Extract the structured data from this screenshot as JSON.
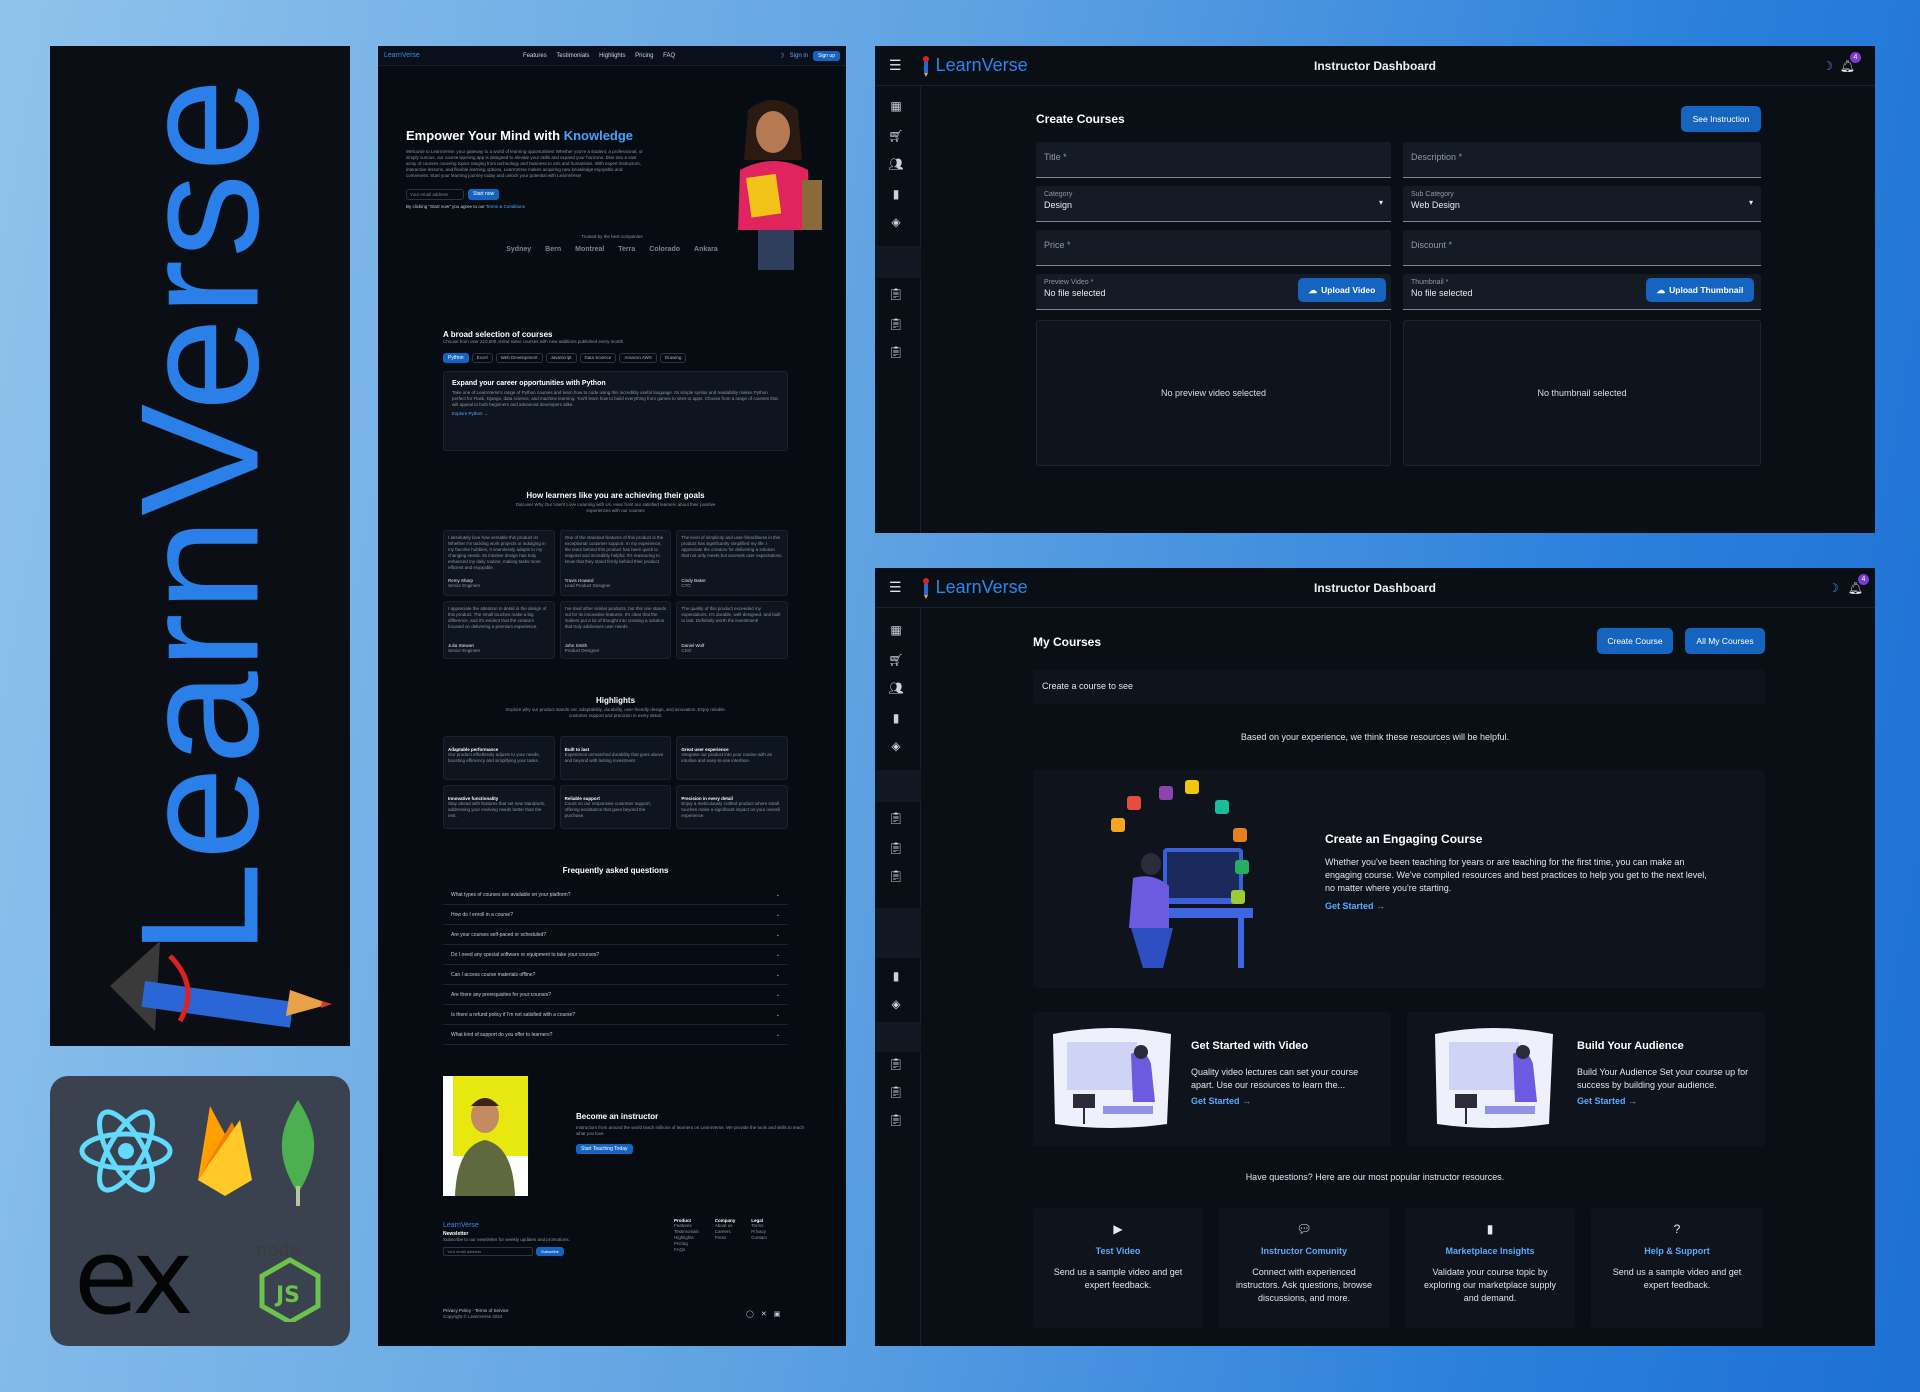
{
  "logo": {
    "wordmark": "LearnVerse"
  },
  "landing": {
    "nav": {
      "brand": "LearnVerse",
      "links": [
        "Features",
        "Testimonials",
        "Highlights",
        "Pricing",
        "FAQ"
      ],
      "signin": "Sign in",
      "signup": "Sign up"
    },
    "hero": {
      "title": "Empower Your Mind with",
      "title_highlight": "Knowledge",
      "text": "Welcome to LearnVerse: your gateway to a world of learning opportunities! Whether you're a student, a professional, or simply curious, our course learning app is designed to elevate your skills and expand your horizons. Dive into a vast array of courses covering topics ranging from technology and business to arts and humanities. With expert instructors, interactive lessons, and flexible learning options, LearnVerse makes acquiring new knowledge enjoyable and convenient. Start your learning journey today and unlock your potential with LearnVerse!",
      "email_placeholder": "Your email address",
      "start_button": "Start now",
      "terms_text": "By clicking \"Start now\" you agree to our",
      "terms_link": "Terms & Conditions"
    },
    "trusted": {
      "label": "Trusted by the best companies",
      "companies": [
        "Sydney",
        "Bern",
        "Montreal",
        "Terra",
        "Colorado",
        "Ankara"
      ]
    },
    "courses": {
      "title": "A broad selection of courses",
      "subtitle": "Choose from over 210,000 online video courses with new additions published every month",
      "tabs": [
        "Python",
        "Excel",
        "Web Development",
        "JavaScript",
        "Data Science",
        "Amazon AWS",
        "Drawing"
      ],
      "card_title": "Expand your career opportunities with Python",
      "card_text": "Take one of LearnVerse's range of Python courses and learn how to code using this incredibly useful language. Its simple syntax and readability makes Python perfect for Flask, Django, data science, and machine learning. You'll learn how to build everything from games to sites to apps. Choose from a range of courses that will appeal to both beginners and advanced developers alike.",
      "card_link": "Explore Python"
    },
    "testimonials": {
      "title": "How learners like you are achieving their goals",
      "subtitle": "Discover Why Our Users Love Learning with Us. Hear from our satisfied learners about their positive experiences with our courses",
      "items": [
        {
          "text": "I absolutely love how versatile this product is! Whether I'm tackling work projects or indulging in my favorite hobbies, it seamlessly adapts to my changing needs. Its intuitive design has truly enhanced my daily routine, making tasks more efficient and enjoyable.",
          "name": "Remy Sharp",
          "role": "Senior Engineer",
          "logo": "Sydney"
        },
        {
          "text": "One of the standout features of this product is the exceptional customer support. In my experience, the team behind this product has been quick to respond and incredibly helpful. It's reassuring to know that they stand firmly behind their product.",
          "name": "Travis Howard",
          "role": "Lead Product Designer",
          "logo": "Bern"
        },
        {
          "text": "The level of simplicity and user-friendliness in this product has significantly simplified my life. I appreciate the creators for delivering a solution that not only meets but exceeds user expectations.",
          "name": "Cindy Baker",
          "role": "CTO",
          "logo": "Montreal"
        },
        {
          "text": "I appreciate the attention to detail in the design of this product. The small touches make a big difference, and it's evident that the creators focused on delivering a premium experience.",
          "name": "Julia Stewart",
          "role": "Senior Engineer",
          "logo": "Terra"
        },
        {
          "text": "I've tried other similar products, but this one stands out for its innovative features. It's clear that the makers put a lot of thought into creating a solution that truly addresses user needs.",
          "name": "John Smith",
          "role": "Product Designer",
          "logo": "Colorado"
        },
        {
          "text": "The quality of this product exceeded my expectations. It's durable, well-designed, and built to last. Definitely worth the investment!",
          "name": "Daniel Wolf",
          "role": "CDO",
          "logo": "Ankara"
        }
      ]
    },
    "highlights": {
      "title": "Highlights",
      "subtitle": "Explore why our product stands out: adaptability, durability, user-friendly design, and innovation. Enjoy reliable customer support and precision in every detail.",
      "items": [
        {
          "title": "Adaptable performance",
          "text": "Our product effortlessly adjusts to your needs, boosting efficiency and simplifying your tasks."
        },
        {
          "title": "Built to last",
          "text": "Experience unmatched durability that goes above and beyond with lasting investment."
        },
        {
          "title": "Great user experience",
          "text": "Integrate our product into your routine with an intuitive and easy-to-use interface."
        },
        {
          "title": "Innovative functionality",
          "text": "Stay ahead with features that set new standards, addressing your evolving needs better than the rest."
        },
        {
          "title": "Reliable support",
          "text": "Count on our responsive customer support, offering assistance that goes beyond the purchase."
        },
        {
          "title": "Precision in every detail",
          "text": "Enjoy a meticulously crafted product where small touches make a significant impact on your overall experience."
        }
      ]
    },
    "faq": {
      "title": "Frequently asked questions",
      "items": [
        "What types of courses are available on your platform?",
        "How do I enroll in a course?",
        "Are your courses self-paced or scheduled?",
        "Do I need any special software or equipment to take your courses?",
        "Can I access course materials offline?",
        "Are there any prerequisites for your courses?",
        "Is there a refund policy if I'm not satisfied with a course?",
        "What kind of support do you offer to learners?"
      ]
    },
    "instructor": {
      "title": "Become an instructor",
      "text": "Instructors from around the world teach millions of learners on LearnVerse. We provide the tools and skills to teach what you love.",
      "button": "Start Teaching Today"
    },
    "footer": {
      "brand": "LearnVerse",
      "newsletter": "Newsletter",
      "newsletter_text": "Subscribe to our newsletter for weekly updates and promotions.",
      "email_placeholder": "Your email address",
      "subscribe": "Subscribe",
      "cols": [
        {
          "title": "Product",
          "items": [
            "Features",
            "Testimonials",
            "Highlights",
            "Pricing",
            "FAQs"
          ]
        },
        {
          "title": "Company",
          "items": [
            "About us",
            "Careers",
            "Press"
          ]
        },
        {
          "title": "Legal",
          "items": [
            "Terms",
            "Privacy",
            "Contact"
          ]
        }
      ],
      "privacy": "Privacy Policy",
      "terms": "Terms of Service",
      "copyright": "Copyright © LearnVerse 2024"
    }
  },
  "dash1": {
    "brand": "LearnVerse",
    "title": "Instructor Dashboard",
    "badge": "4",
    "heading": "Create Courses",
    "see_button": "See Instruction",
    "title_field": "Title *",
    "desc_field": "Description *",
    "category_label": "Category",
    "category_value": "Design",
    "subcat_label": "Sub Category",
    "subcat_value": "Web Design",
    "price_field": "Price *",
    "discount_field": "Discount *",
    "preview_label": "Preview Video *",
    "preview_value": "No file selected",
    "upload_video": "Upload Video",
    "thumb_label": "Thumbnail *",
    "thumb_value": "No file selected",
    "upload_thumb": "Upload Thumbnail",
    "no_preview": "No preview video selected",
    "no_thumb": "No thumbnail selected"
  },
  "dash2": {
    "brand": "LearnVerse",
    "title": "Instructor Dashboard",
    "badge": "4",
    "heading": "My Courses",
    "create_button": "Create Course",
    "all_button": "All My Courses",
    "empty": "Create a course to see",
    "based": "Based on your experience, we think these resources will be helpful.",
    "engage_title": "Create an Engaging Course",
    "engage_text": "Whether you've been teaching for years or are teaching for the first time, you can make an engaging course. We've compiled resources and best practices to help you get to the next level, no matter where you're starting.",
    "get_started": "Get Started",
    "video_title": "Get Started with Video",
    "video_text": "Quality video lectures can set your course apart. Use our resources to learn the...",
    "audience_title": "Build Your Audience",
    "audience_text": "Build Your Audience Set your course up for success by building your audience.",
    "questions": "Have questions? Here are our most popular instructor resources.",
    "resources": [
      {
        "icon": "play-icon",
        "title": "Test Video",
        "text": "Send us a sample video and get expert feedback."
      },
      {
        "icon": "forum-icon",
        "title": "Instructor Comunity",
        "text": "Connect with experienced instructors. Ask questions, browse discussions, and more."
      },
      {
        "icon": "bar-chart-icon",
        "title": "Marketplace Insights",
        "text": "Validate your course topic by exploring our marketplace supply and demand."
      },
      {
        "icon": "help-icon",
        "title": "Help & Support",
        "text": "Send us a sample video and get expert feedback."
      }
    ]
  },
  "colors": {
    "accent": "#1565c0",
    "link": "#5aa9ff",
    "brand": "#2e86ea",
    "bg": "#0a0e15"
  }
}
